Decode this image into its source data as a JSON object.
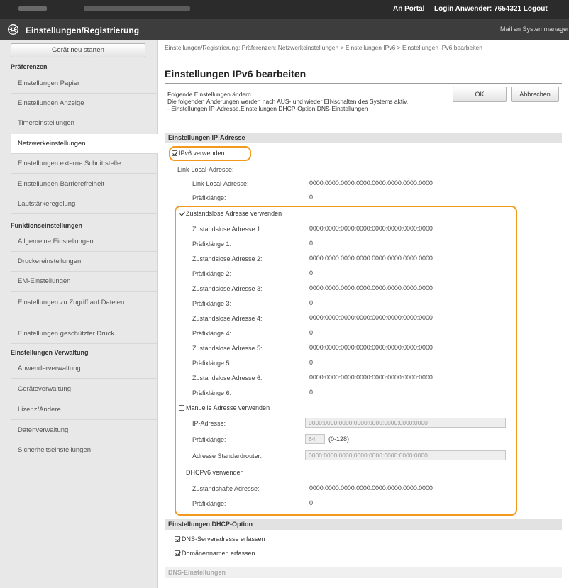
{
  "header": {
    "portal": "An Portal",
    "login": "Login Anwender:  7654321  Logout",
    "title": "Einstellungen/Registrierung",
    "mail": "Mail an Systemmanager"
  },
  "sidebar": {
    "restart": "Gerät neu starten",
    "preferences_head": "Präferenzen",
    "preferences": [
      "Einstellungen Papier",
      "Einstellungen Anzeige",
      "Timereinstellungen",
      "Netzwerkeinstellungen",
      "Einstellungen externe Schnittstelle",
      "Einstellungen Barrierefreiheit",
      "Lautstärkeregelung"
    ],
    "function_head": "Funktionseinstellungen",
    "functions": [
      "Allgemeine Einstellungen",
      "Druckereinstellungen",
      "EM-Einstellungen",
      "Einstellungen zu Zugriff auf Dateien",
      "Einstellungen geschützter Druck"
    ],
    "mgmt_head": "Einstellungen Verwaltung",
    "mgmt": [
      "Anwenderverwaltung",
      "Geräteverwaltung",
      "Lizenz/Andere",
      "Datenverwaltung",
      "Sicherheitseinstellungen"
    ]
  },
  "main": {
    "breadcrumb": "Einstellungen/Registrierung: Präferenzen: Netzwerkeinstellungen > Einstellungen IPv6 > Einstellungen IPv6 bearbeiten",
    "title": "Einstellungen IPv6 bearbeiten",
    "intro": [
      "Folgende Einstellungen ändern.",
      "Die folgenden Änderungen werden nach AUS- und wieder EINschalten des Systems aktiv.",
      "- Einstellungen IP-Adresse,Einstellungen DHCP-Option,DNS-Einstellungen"
    ],
    "ok": "OK",
    "cancel": "Abbrechen",
    "ip_section": "Einstellungen IP-Adresse",
    "use_ipv6": "IPv6 verwenden",
    "link_local_head": "Link-Local-Adresse:",
    "link_local_label": "Link-Local-Adresse:",
    "link_local_value": "0000:0000:0000:0000:0000:0000:0000:0000",
    "prefix_label": "Präfixlänge:",
    "prefix_value": "0",
    "use_stateless": "Zustandslose Adresse verwenden",
    "stateless": [
      {
        "label": "Zustandslose Adresse 1:",
        "value": "0000:0000:0000:0000:0000:0000:0000:0000",
        "plabel": "Präfixlänge 1:",
        "pvalue": "0"
      },
      {
        "label": "Zustandslose Adresse 2:",
        "value": "0000:0000:0000:0000:0000:0000:0000:0000",
        "plabel": "Präfixlänge 2:",
        "pvalue": "0"
      },
      {
        "label": "Zustandslose Adresse 3:",
        "value": "0000:0000:0000:0000:0000:0000:0000:0000",
        "plabel": "Präfixlänge 3:",
        "pvalue": "0"
      },
      {
        "label": "Zustandslose Adresse 4:",
        "value": "0000:0000:0000:0000:0000:0000:0000:0000",
        "plabel": "Präfixlänge 4:",
        "pvalue": "0"
      },
      {
        "label": "Zustandslose Adresse 5:",
        "value": "0000:0000:0000:0000:0000:0000:0000:0000",
        "plabel": "Präfixlänge 5:",
        "pvalue": "0"
      },
      {
        "label": "Zustandslose Adresse 6:",
        "value": "0000:0000:0000:0000:0000:0000:0000:0000",
        "plabel": "Präfixlänge 6:",
        "pvalue": "0"
      }
    ],
    "use_manual": "Manuelle Adresse verwenden",
    "ip_label": "IP-Adresse:",
    "ip_value": "0000:0000:0000:0000:0000:0000:0000:0000",
    "manual_prefix_label": "Präfixlänge:",
    "manual_prefix_value": "64",
    "manual_prefix_hint": "(0-128)",
    "router_label": "Adresse Standardrouter:",
    "router_value": "0000:0000:0000:0000:0000:0000:0000:0000",
    "use_dhcpv6": "DHCPv6 verwenden",
    "stateful_label": "Zustandshafte Adresse:",
    "stateful_value": "0000:0000:0000:0000:0000:0000:0000:0000",
    "stateful_prefix_label": "Präfixlänge:",
    "stateful_prefix_value": "0",
    "dhcp_section": "Einstellungen DHCP-Option",
    "dns_server": "DNS-Serveradresse erfassen",
    "domain_name": "Domänennamen erfassen",
    "dns_section": "DNS-Einstellungen"
  },
  "colors": {
    "highlight": "#f29a1b",
    "header": "#2b2b2b"
  }
}
